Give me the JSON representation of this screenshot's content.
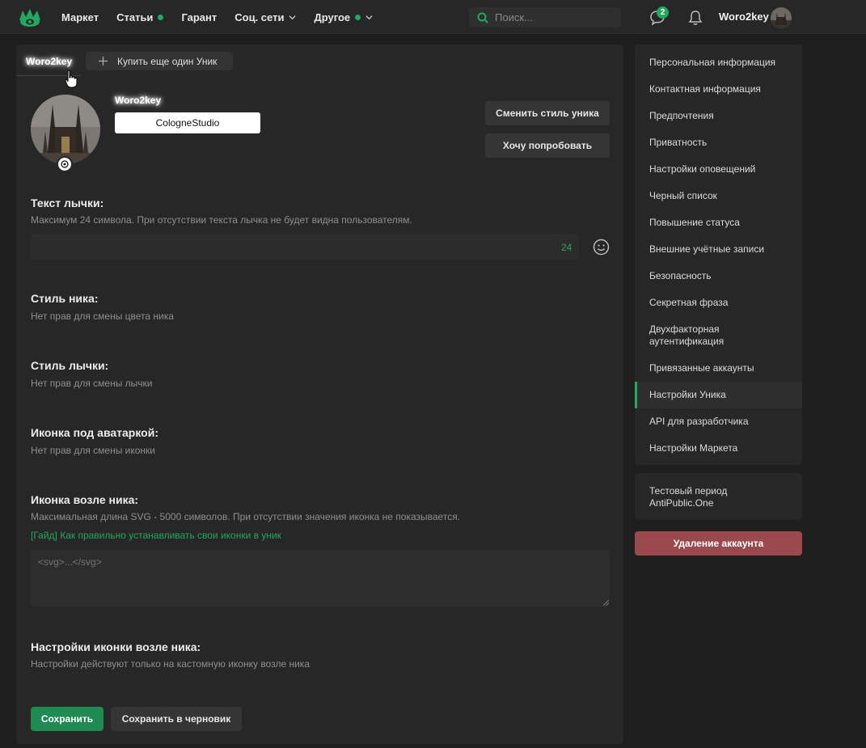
{
  "header": {
    "nav": [
      {
        "label": "Маркет",
        "dot": false,
        "chevron": false
      },
      {
        "label": "Статьи",
        "dot": true,
        "chevron": false
      },
      {
        "label": "Гарант",
        "dot": false,
        "chevron": false
      },
      {
        "label": "Соц. сети",
        "dot": false,
        "chevron": true
      },
      {
        "label": "Другое",
        "dot": true,
        "chevron": true
      }
    ],
    "search_placeholder": "Поиск...",
    "messages_count": "2",
    "username": "Woro2key",
    "accent": "#22a85f"
  },
  "tabs": {
    "active": "Woro2key",
    "buy_label": "Купить еще один Уник"
  },
  "profile": {
    "display_name": "Woro2key",
    "banner_text": "CologneStudio",
    "change_style_button": "Сменить стиль уника",
    "try_button": "Хочу попробовать"
  },
  "sections": {
    "badge_text_title": "Текст лычки:",
    "badge_text_desc": "Максимум 24 символа. При отсутствии текста лычка не будет видна пользователям.",
    "badge_text_counter": "24",
    "nick_style_title": "Стиль ника:",
    "nick_style_desc": "Нет прав для смены цвета ника",
    "badge_style_title": "Стиль лычки:",
    "badge_style_desc": "Нет прав для смены лычки",
    "avatar_icon_title": "Иконка под аватаркой:",
    "avatar_icon_desc": "Нет прав для смены иконки",
    "nick_icon_title": "Иконка возле ника:",
    "nick_icon_desc": "Максимальная длина SVG - 5000 символов. При отсутствии значения иконка не показывается.",
    "nick_icon_guide": "[Гайд] Как правильно устанавливать свои иконки в уник",
    "nick_icon_placeholder": "<svg>...</svg>",
    "nick_icon_settings_title": "Настройки иконки возле ника:",
    "nick_icon_settings_desc": "Настройки действуют только на кастомную иконку возле ника"
  },
  "actions": {
    "save": "Сохранить",
    "save_draft": "Сохранить в черновик"
  },
  "sidebar": {
    "items": [
      "Персональная информация",
      "Контактная информация",
      "Предпочтения",
      "Приватность",
      "Настройки оповещений",
      "Черный список",
      "Повышение статуса",
      "Внешние учётные записи",
      "Безопасность",
      "Секретная фраза",
      "Двухфакторная аутентификация",
      "Привязанные аккаунты",
      "Настройки Уника",
      "API для разработчика",
      "Настройки Маркета"
    ],
    "active_item": "Настройки Уника",
    "trial": "Тестовый период AntiPublic.One",
    "delete_account": "Удаление аккаунта"
  }
}
